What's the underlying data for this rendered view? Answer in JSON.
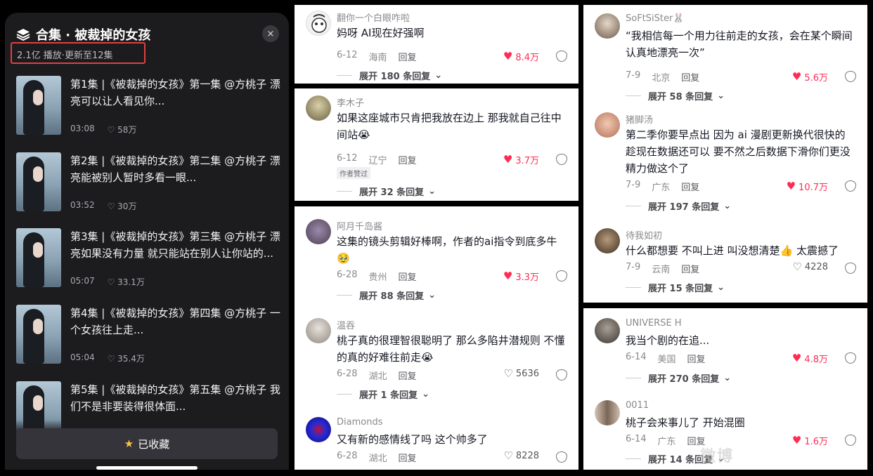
{
  "collection": {
    "title": "合集 · 被裁掉的女孩",
    "stats": "2.1亿 播放·更新至12集",
    "close_icon": "×",
    "collect_label": "已收藏",
    "episodes": [
      {
        "title": "第1集 |《被裁掉的女孩》第一集 @方桃子 漂亮可以让人看见你...",
        "duration": "03:08",
        "likes": "58万"
      },
      {
        "title": "第2集 |《被裁掉的女孩》第二集 @方桃子 漂亮能被别人暂时多看一眼...",
        "duration": "03:52",
        "likes": "30万"
      },
      {
        "title": "第3集 |《被裁掉的女孩》第三集 @方桃子 漂亮如果没有力量 就只能站在别人让你站的...",
        "duration": "05:07",
        "likes": "33.1万"
      },
      {
        "title": "第4集 |《被裁掉的女孩》第四集 @方桃子 一个女孩往上走...",
        "duration": "05:04",
        "likes": "35.4万"
      },
      {
        "title": "第5集 |《被裁掉的女孩》第五集 @方桃子 我们不是非要装得很体面...",
        "duration": "",
        "likes": ""
      }
    ]
  },
  "col2": [
    {
      "user": "翻你一个白眼咋啦",
      "text": "妈呀 AI现在好强啊",
      "date": "6-12",
      "loc": "海南",
      "reply": "回复",
      "likes": "8.4万",
      "hot": true,
      "expand": "展开 180 条回复"
    },
    {
      "user": "李木子",
      "text": "如果这座城市只肯把我放在边上 那我就自己往中间站😭",
      "date": "6-12",
      "loc": "辽宁",
      "reply": "回复",
      "likes": "3.7万",
      "hot": true,
      "tag": "作者赞过",
      "expand": "展开 32 条回复"
    },
    {
      "user": "阿月千岛酱",
      "text": "这集的镜头剪辑好棒啊，作者的ai指令到底多牛🥹",
      "date": "6-28",
      "loc": "贵州",
      "reply": "回复",
      "likes": "3.3万",
      "hot": true,
      "expand": "展开 88 条回复"
    },
    {
      "user": "温吞",
      "text": "桃子真的很理智很聪明了 那么多陷井潜规则 不懂的真的好难往前走😭",
      "date": "6-28",
      "loc": "湖北",
      "reply": "回复",
      "likes": "5636",
      "hot": false,
      "expand": "展开 1 条回复"
    },
    {
      "user": "Diamonds",
      "text": "又有新的感情线了吗 这个帅多了",
      "date": "6-28",
      "loc": "湖北",
      "reply": "回复",
      "likes": "8228",
      "hot": false
    }
  ],
  "col3": [
    {
      "user": "SoFtSiSter🐰",
      "text": "“我相信每一个用力往前走的女孩，会在某个瞬间认真地漂亮一次”",
      "date": "7-9",
      "loc": "北京",
      "reply": "回复",
      "likes": "5.6万",
      "hot": true,
      "expand": "展开 58 条回复"
    },
    {
      "user": "猪脚汤",
      "text": "第二季你要早点出 因为 ai 漫剧更新换代很快的 趁现在数据还可以 要不然之后数据下滑你们更没精力做这个了",
      "date": "7-9",
      "loc": "广东",
      "reply": "回复",
      "likes": "10.7万",
      "hot": true,
      "expand": "展开 197 条回复"
    },
    {
      "user": "待我如初",
      "text": "什么都想要 不叫上进 叫没想清楚👍 太震撼了",
      "date": "7-9",
      "loc": "云南",
      "reply": "回复",
      "likes": "4228",
      "hot": false,
      "expand": "展开 15 条回复"
    },
    {
      "user": "UNIVERSE H",
      "text": "我当个剧的在追...",
      "date": "6-14",
      "loc": "美国",
      "reply": "回复",
      "likes": "4.8万",
      "hot": true,
      "expand": "展开 270 条回复"
    },
    {
      "user": "0011",
      "text": "桃子会来事儿了 开始混圈",
      "date": "6-14",
      "loc": "广东",
      "reply": "回复",
      "likes": "1.6万",
      "hot": true,
      "expand": "展开 14 条回复"
    }
  ],
  "watermark": "微博"
}
